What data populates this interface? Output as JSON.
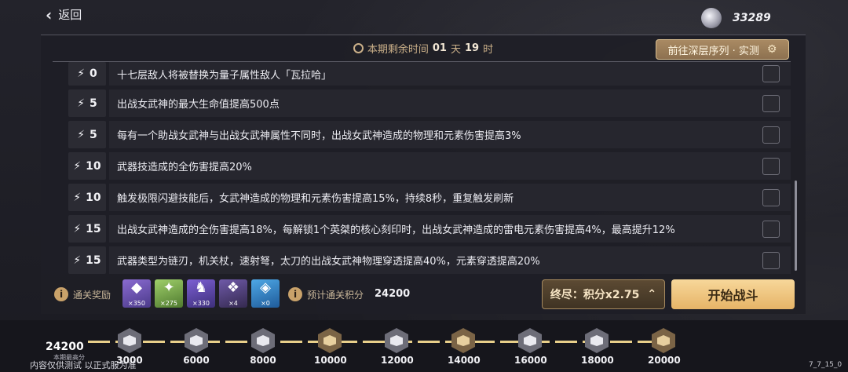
{
  "header": {
    "back_label": "返回",
    "currency_amount": "33289",
    "currency_icon": "crystal-icon"
  },
  "timer": {
    "prefix": "本期剩余时间",
    "days": "01",
    "days_unit": "天",
    "hours": "19",
    "hours_unit": "时"
  },
  "goto_button": {
    "label": "前往深层序列 · 实测",
    "icon": "gear-icon"
  },
  "modifiers": [
    {
      "value": "0",
      "text": "十七层敌人将被替换为量子属性敌人「瓦拉哈」",
      "checked": false
    },
    {
      "value": "5",
      "text": "出战女武神的最大生命值提高500点",
      "checked": false
    },
    {
      "value": "5",
      "text": "每有一个助战女武神与出战女武神属性不同时，出战女武神造成的物理和元素伤害提高3%",
      "checked": false
    },
    {
      "value": "10",
      "text": "武器技造成的全伤害提高20%",
      "checked": false
    },
    {
      "value": "10",
      "text": "触发极限闪避技能后，女武神造成的物理和元素伤害提高15%，持续8秒，重复触发刷新",
      "checked": false
    },
    {
      "value": "15",
      "text": "出战女武神造成的全伤害提高18%，每解锁1个英桀的核心刻印时，出战女武神造成的雷电元素伤害提高4%，最高提升12%",
      "checked": false
    },
    {
      "value": "15",
      "text": "武器类型为链刃，机关杖，速射弩，太刀的出战女武神物理穿透提高40%，元素穿透提高20%",
      "checked": false
    }
  ],
  "rewards": {
    "label": "通关奖励",
    "items": [
      {
        "icon": "valkyrie-fragment-icon",
        "count": "×350"
      },
      {
        "icon": "stamp-icon",
        "count": "×275"
      },
      {
        "icon": "character-chip-icon",
        "count": "×330"
      },
      {
        "icon": "material-icon",
        "count": "×4"
      },
      {
        "icon": "crystal-cluster-icon",
        "count": "×0"
      }
    ]
  },
  "score": {
    "label": "预计通关积分",
    "value": "24200"
  },
  "difficulty": {
    "label": "终尽：积分x2.75",
    "icon": "chevron-up-icon"
  },
  "start_button": {
    "label": "开始战斗"
  },
  "progress": {
    "current_score": "24200",
    "current_label": "本期最高分",
    "disclaimer": "内容仅供测试 以正式服为准",
    "milestones": [
      {
        "label": "3000",
        "tier": "silver"
      },
      {
        "label": "6000",
        "tier": "silver"
      },
      {
        "label": "8000",
        "tier": "silver"
      },
      {
        "label": "10000",
        "tier": "bronze"
      },
      {
        "label": "12000",
        "tier": "silver"
      },
      {
        "label": "14000",
        "tier": "bronze"
      },
      {
        "label": "16000",
        "tier": "silver"
      },
      {
        "label": "18000",
        "tier": "silver"
      },
      {
        "label": "20000",
        "tier": "bronze"
      }
    ]
  },
  "version": "7_7_15_0"
}
